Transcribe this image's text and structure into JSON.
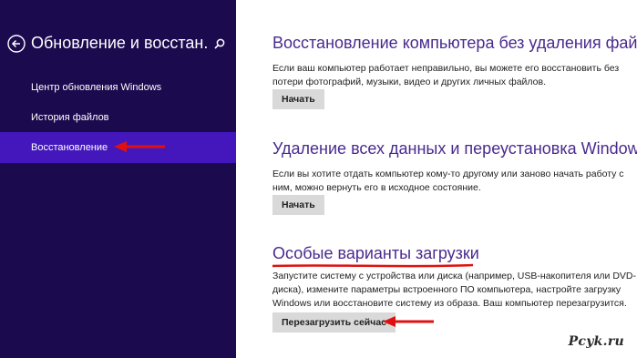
{
  "sidebar": {
    "title": "Обновление и восстан...",
    "items": [
      {
        "label": "Центр обновления Windows"
      },
      {
        "label": "История файлов"
      },
      {
        "label": "Восстановление"
      }
    ]
  },
  "sections": [
    {
      "title": "Восстановление компьютера без удаления файлов",
      "desc": "Если ваш компьютер работает неправильно, вы можете его восстановить без потери фотографий, музыки, видео и других личных файлов.",
      "button": "Начать"
    },
    {
      "title": "Удаление всех данных и переустановка Windows",
      "desc": "Если вы хотите отдать компьютер кому-то другому или заново начать работу с ним, можно вернуть его в исходное состояние.",
      "button": "Начать"
    },
    {
      "title": "Особые варианты загрузки",
      "desc": "Запустите систему с устройства или диска (например, USB-накопителя или DVD-диска), измените параметры встроенного ПО компьютера, настройте загрузку Windows или восстановите систему из образа. Ваш компьютер перезагрузится.",
      "button": "Перезагрузить сейчас"
    }
  ],
  "watermark": "Pcyk.ru",
  "colors": {
    "sidebar_bg": "#1c0a4f",
    "selected_bg": "#4317bb",
    "title_color": "#4a2a8e",
    "annotation_red": "#e01010"
  },
  "icons": {
    "back": "back-arrow-icon",
    "search": "search-icon"
  }
}
